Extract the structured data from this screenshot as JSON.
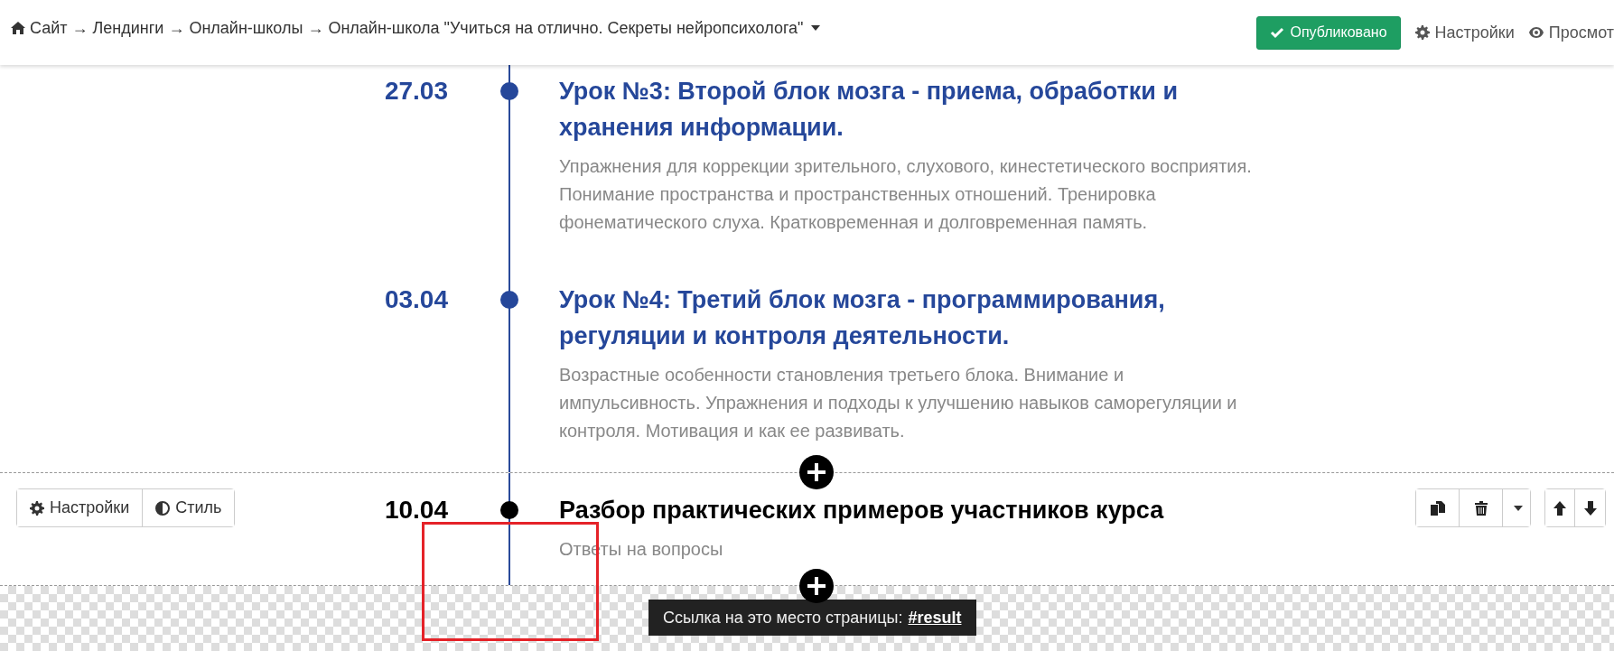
{
  "header": {
    "breadcrumb": "Сайт → Лендинги → Онлайн-школы → Онлайн-школа \"Учиться на отлично. Секреты нейропсихолога\"",
    "status_button": {
      "label": "Опубликовано"
    },
    "links": [
      {
        "label": "Настройки"
      },
      {
        "label": "Просмот"
      }
    ]
  },
  "blocks": [
    {
      "selected": false,
      "lessons": [
        {
          "date": "27.03",
          "title": "Урок №3: Второй блок мозга - приема, обработки и хранения информации.",
          "description": "Упражнения для коррекции зрительного, слухового, кинестетического восприятия. Понимание пространства и пространственных отношений. Тренировка фонематического слуха. Кратковременная и долговременная память."
        },
        {
          "date": "03.04",
          "title": "Урок №4: Третий блок мозга - программирования, регуляции и контроля деятельности.",
          "description": "Возрастные особенности становления третьего блока. Внимание и импульсивность. Упражнения и подходы к улучшению навыков саморегуляции и контроля. Мотивация и как ее развивать."
        }
      ]
    },
    {
      "selected": true,
      "lessons": [
        {
          "date": "10.04",
          "title": "Разбор практических примеров участников курса",
          "description": "Ответы на вопросы"
        }
      ]
    }
  ],
  "block_toolbar": {
    "buttons": [
      {
        "label": "Настройки"
      },
      {
        "label": "Стиль"
      }
    ]
  },
  "anchor_tooltip": {
    "text": "Ссылка на это место страницы:",
    "anchor": "#result"
  }
}
